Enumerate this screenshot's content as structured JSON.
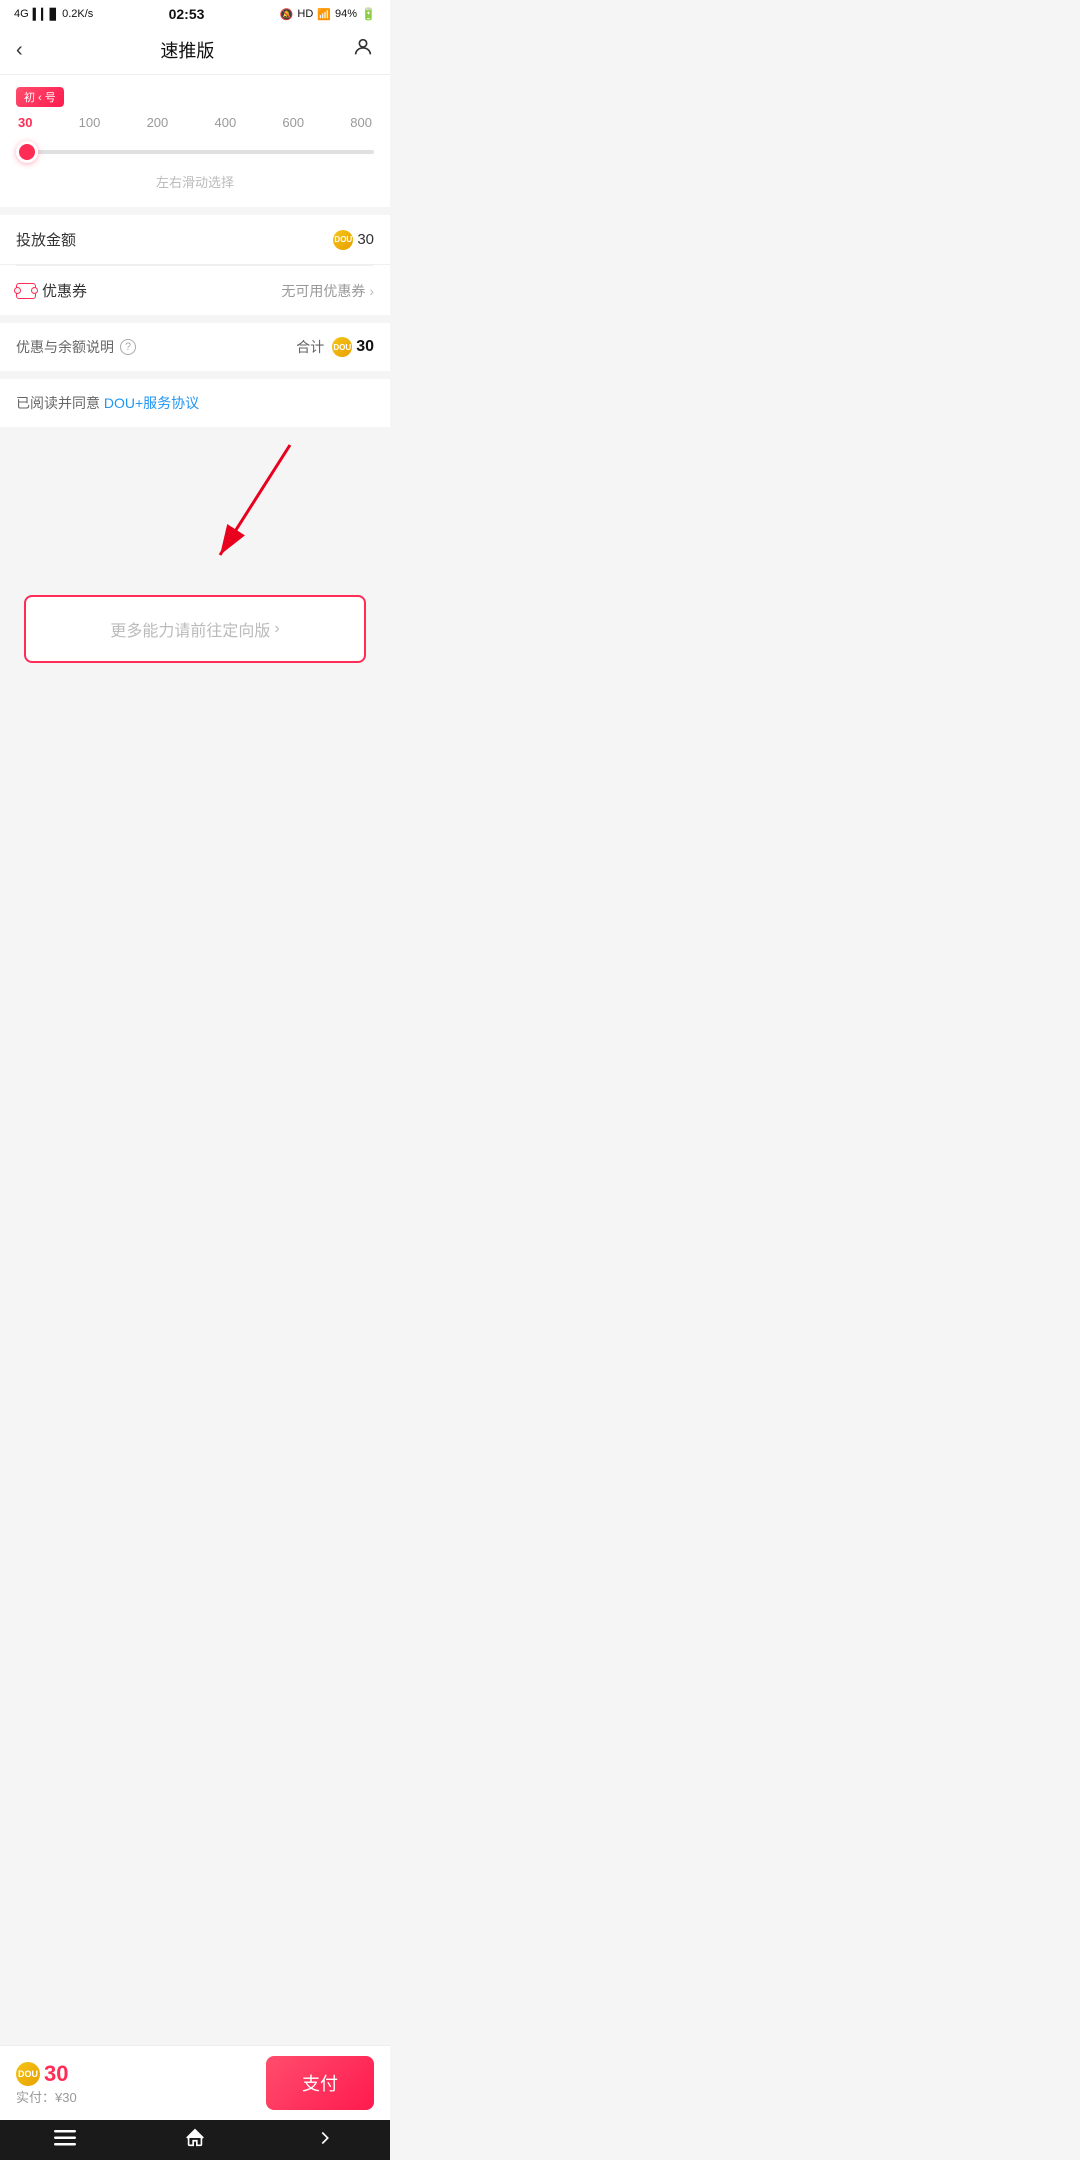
{
  "statusBar": {
    "network": "4G",
    "signal": "0.2K/s",
    "time": "02:53",
    "alarm": "HD",
    "wifi": "wifi",
    "battery": "94%"
  },
  "header": {
    "back": "‹",
    "title": "速推版",
    "profileIcon": "👤"
  },
  "sliderSection": {
    "tag": "初 ‹ 号",
    "labels": [
      "30",
      "100",
      "200",
      "400",
      "600",
      "800"
    ],
    "hint": "左右滑动选择"
  },
  "amountRow": {
    "label": "投放金额",
    "value": "30"
  },
  "couponRow": {
    "label": "优惠券",
    "value": "无可用优惠券",
    "chevron": "›"
  },
  "summaryRow": {
    "label": "优惠与余额说明",
    "helpIcon": "?",
    "total": "合计",
    "amount": "30"
  },
  "agreement": {
    "prefix": "已阅读并同意 ",
    "linkText": "DOU+服务协议"
  },
  "moreButton": {
    "text": "更多能力请前往定向版",
    "chevron": "›"
  },
  "bottomBar": {
    "amount": "30",
    "actual": "实付：¥30",
    "payButton": "支付"
  },
  "navBar": {
    "menu": "☰",
    "home": "⌂",
    "back": "↩"
  }
}
